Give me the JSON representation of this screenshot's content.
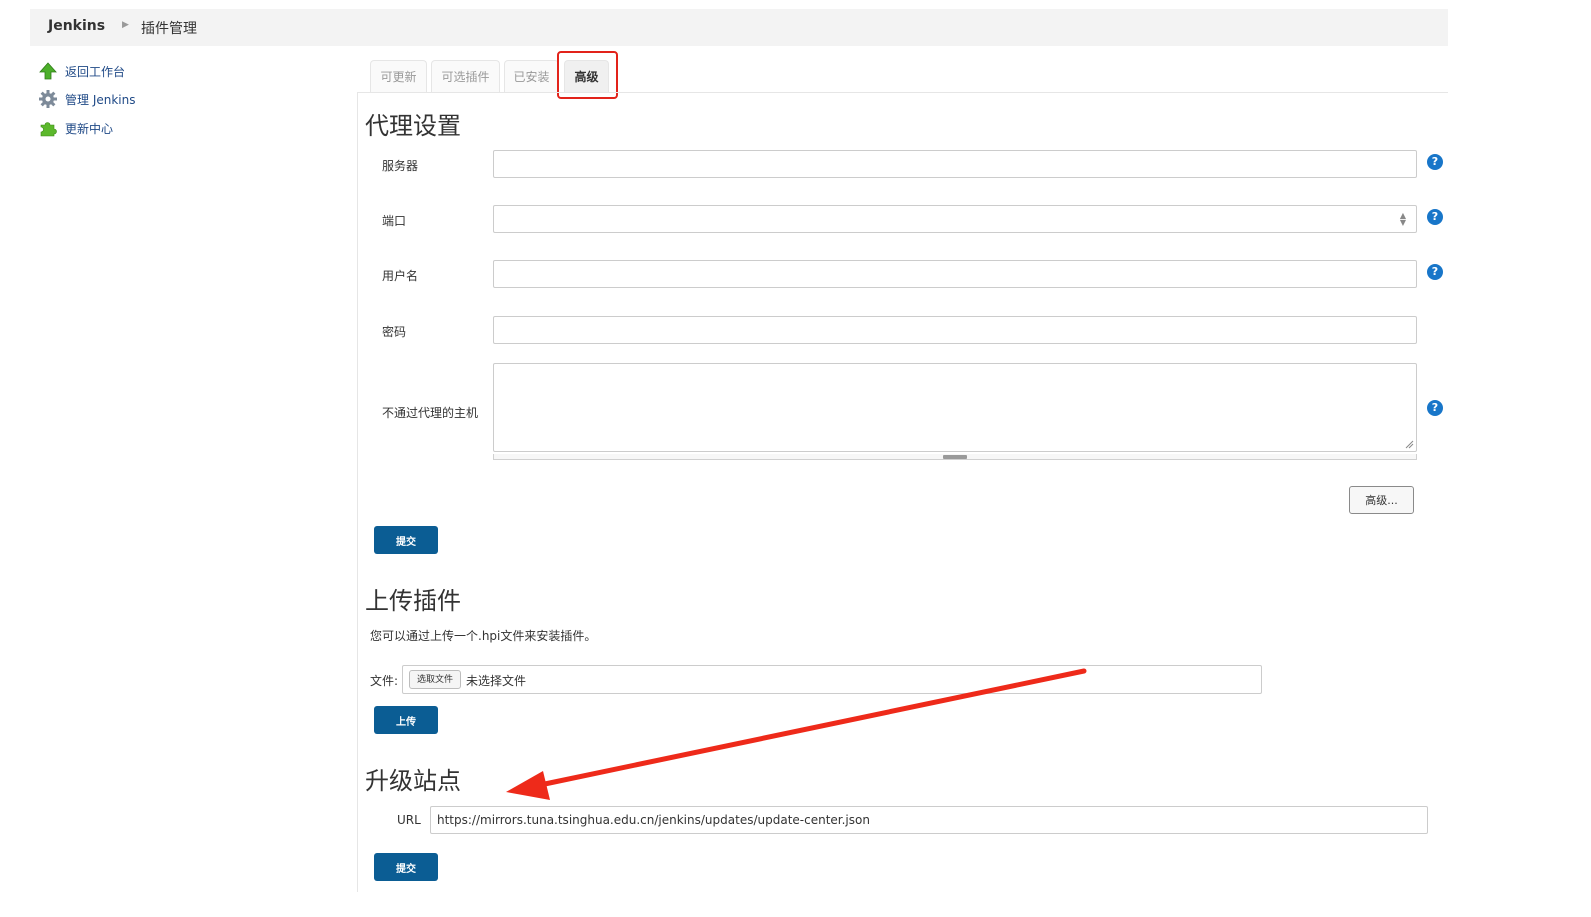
{
  "breadcrumb": {
    "root": "Jenkins",
    "current": "插件管理"
  },
  "sidebar": {
    "items": [
      {
        "label": "返回工作台",
        "icon": "up-arrow-icon"
      },
      {
        "label": "管理 Jenkins",
        "icon": "gear-icon"
      },
      {
        "label": "更新中心",
        "icon": "puzzle-icon"
      }
    ]
  },
  "tabs": [
    {
      "label": "可更新",
      "active": false
    },
    {
      "label": "可选插件",
      "active": false
    },
    {
      "label": "已安装",
      "active": false
    },
    {
      "label": "高级",
      "active": true
    }
  ],
  "proxy": {
    "title": "代理设置",
    "server_label": "服务器",
    "port_label": "端口",
    "username_label": "用户名",
    "password_label": "密码",
    "no_proxy_label": "不通过代理的主机",
    "server_value": "",
    "port_value": "",
    "username_value": "",
    "password_value": "",
    "no_proxy_value": "",
    "advanced_button": "高级...",
    "submit_button": "提交",
    "help_glyph": "?"
  },
  "upload": {
    "title": "上传插件",
    "description": "您可以通过上传一个.hpi文件来安装插件。",
    "file_label": "文件:",
    "choose_button": "选取文件",
    "no_file_text": "未选择文件",
    "upload_button": "上传"
  },
  "update_site": {
    "title": "升级站点",
    "url_label": "URL",
    "url_value": "https://mirrors.tuna.tsinghua.edu.cn/jenkins/updates/update-center.json",
    "submit_button": "提交"
  },
  "colors": {
    "primary_button": "#0b5d94",
    "help_icon": "#1876c9",
    "highlight": "#e2231a",
    "link": "#204a87"
  },
  "spinner_glyphs": {
    "up": "▲",
    "down": "▼"
  }
}
